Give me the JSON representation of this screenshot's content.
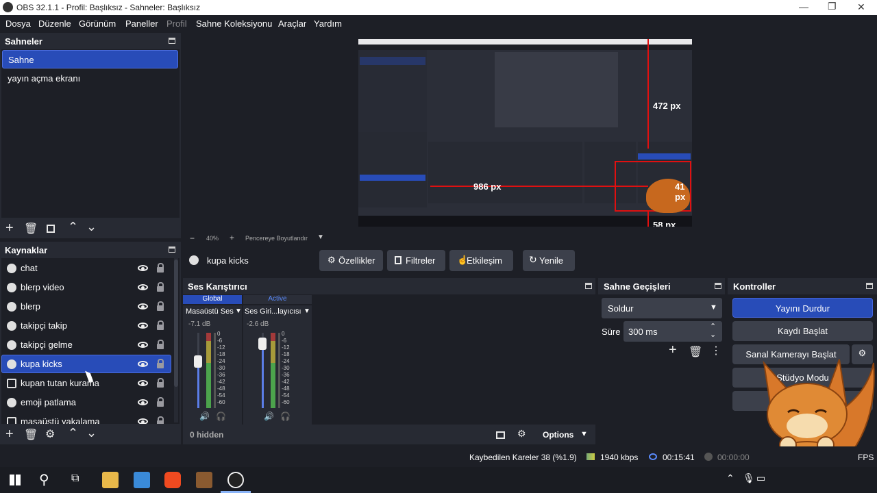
{
  "window": {
    "title": "OBS 32.1.1 - Profil: Başlıksız - Sahneler: Başlıksız"
  },
  "menu": [
    {
      "label": "Dosya",
      "enabled": true
    },
    {
      "label": "Düzenle",
      "enabled": true
    },
    {
      "label": "Görünüm",
      "enabled": true
    },
    {
      "label": "Paneller",
      "enabled": true
    },
    {
      "label": "Profil",
      "enabled": false
    },
    {
      "label": "Sahne Koleksiyonu",
      "enabled": true
    },
    {
      "label": "Araçlar",
      "enabled": true
    },
    {
      "label": "Yardım",
      "enabled": true
    }
  ],
  "scenes": {
    "title": "Sahneler",
    "items": [
      {
        "label": "Sahne",
        "selected": true
      },
      {
        "label": "yayın açma ekranı",
        "selected": false
      }
    ]
  },
  "preview": {
    "zoom": "40%",
    "resize_label": "Pencereye Boyutlandır",
    "measure_labels": {
      "top": "472 px",
      "left": "986 px",
      "right": "41 px",
      "bottom": "58 px"
    }
  },
  "sources": {
    "title": "Kaynaklar",
    "items": [
      {
        "label": "chat",
        "icon": "browser-icon",
        "selected": false
      },
      {
        "label": "blerp video",
        "icon": "browser-icon",
        "selected": false
      },
      {
        "label": "blerp",
        "icon": "browser-icon",
        "selected": false
      },
      {
        "label": "takipçi takip",
        "icon": "browser-icon",
        "selected": false
      },
      {
        "label": "takipçi gelme",
        "icon": "browser-icon",
        "selected": false
      },
      {
        "label": "kupa kicks",
        "icon": "browser-icon",
        "selected": true
      },
      {
        "label": "kupan tutan kurama",
        "icon": "image-icon",
        "selected": false
      },
      {
        "label": "emoji patlama",
        "icon": "browser-icon",
        "selected": false
      },
      {
        "label": "masaüstü yakalama",
        "icon": "monitor-icon",
        "selected": false
      }
    ]
  },
  "source_toolbar": {
    "source_name": "kupa kicks",
    "properties": "Özellikler",
    "filters": "Filtreler",
    "interact": "Etkileşim",
    "refresh": "Yenile"
  },
  "mixer": {
    "title": "Ses Karıştırıcı",
    "tabs": [
      "Global",
      "Active"
    ],
    "channels": [
      {
        "name": "Masaüstü Ses",
        "db": "-7.1 dB",
        "level": 0.62
      },
      {
        "name": "Ses Giri...layıcısı",
        "db": "-2.6 dB",
        "level": 0.85
      }
    ],
    "scale": [
      "0",
      "-6",
      "-12",
      "-18",
      "-24",
      "-30",
      "-36",
      "-42",
      "-48",
      "-54",
      "-60"
    ],
    "hidden": "0 hidden",
    "options": "Options"
  },
  "transitions": {
    "title": "Sahne Geçişleri",
    "transition": "Soldur",
    "duration_label": "Süre",
    "duration_value": "300 ms"
  },
  "controls": {
    "title": "Kontroller",
    "stop_stream": "Yayını Durdur",
    "start_record": "Kaydı Başlat",
    "virtual_cam": "Sanal Kamerayı Başlat",
    "studio_mode": "Stüdyo Modu"
  },
  "status": {
    "dropped": "Kaybedilen Kareler 38 (%1.9)",
    "bitrate": "1940 kbps",
    "stream_time": "00:15:41",
    "record_time": "00:00:00",
    "fps": "FPS"
  },
  "colors": {
    "accent": "#284cb8",
    "panel": "#272a33",
    "background": "#1d1f26",
    "guide": "#e01010"
  }
}
